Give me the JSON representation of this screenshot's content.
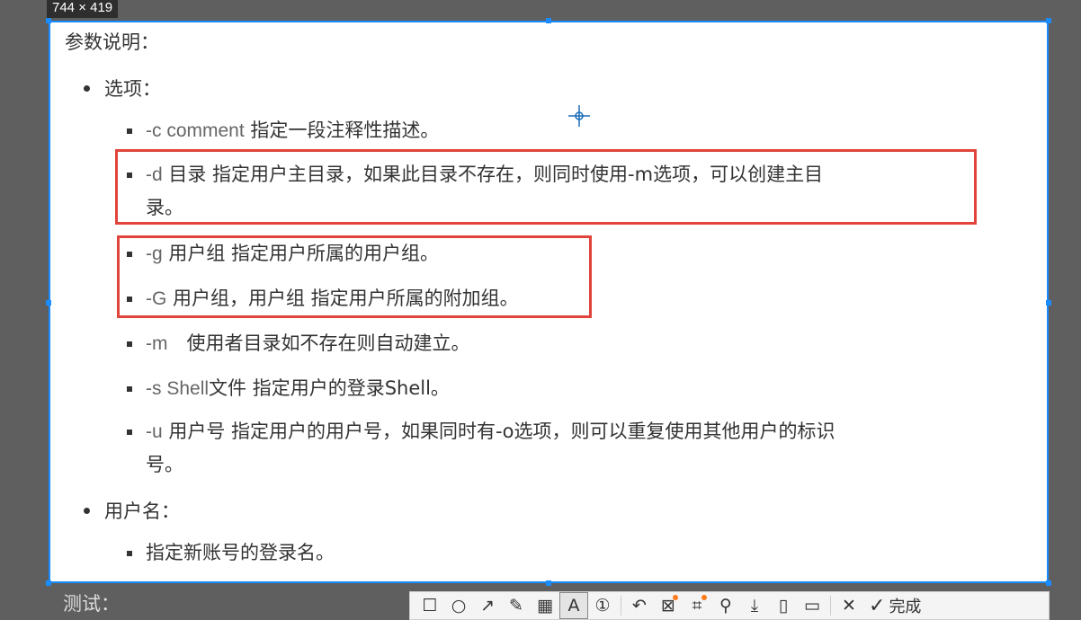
{
  "badge": {
    "size": "744 × 419"
  },
  "content": {
    "heading": "参数说明：",
    "sections": [
      {
        "label": "选项：",
        "items": [
          {
            "cmd": "-c comment",
            "text": " 指定一段注释性描述。"
          },
          {
            "cmd": "-d",
            "text": " 目录 指定用户主目录，如果此目录不存在，则同时使用-m选项，可以创建主目",
            "text2": "录。"
          },
          {
            "cmd": "-g",
            "text": " 用户组 指定用户所属的用户组。"
          },
          {
            "cmd": "-G",
            "text": " 用户组，用户组 指定用户所属的附加组。"
          },
          {
            "cmd": "-m",
            "text": "　使用者目录如不存在则自动建立。"
          },
          {
            "cmd": "-s Shell",
            "text": "文件 指定用户的登录Shell。"
          },
          {
            "cmd": "-u",
            "text": " 用户号 指定用户的用户号，如果同时有-o选项，则可以重复使用其他用户的标识",
            "text2": "号。"
          }
        ]
      },
      {
        "label": "用户名：",
        "items": [
          {
            "cmd": "",
            "text": "指定新账号的登录名。"
          }
        ]
      }
    ]
  },
  "below": {
    "text": "测试："
  },
  "toolbar": {
    "tools": [
      {
        "name": "rectangle-icon",
        "glyph": "☐"
      },
      {
        "name": "ellipse-icon",
        "glyph": "○"
      },
      {
        "name": "arrow-icon",
        "glyph": "↗"
      },
      {
        "name": "pencil-icon",
        "glyph": "✎"
      },
      {
        "name": "mosaic-icon",
        "glyph": "▦"
      },
      {
        "name": "text-icon",
        "glyph": "A"
      },
      {
        "name": "number-icon",
        "glyph": "①"
      },
      {
        "name": "undo-icon",
        "glyph": "↶"
      },
      {
        "name": "pin-erase-icon",
        "glyph": "⊠"
      },
      {
        "name": "ocr-icon",
        "glyph": "⌗"
      },
      {
        "name": "pin-icon",
        "glyph": "⚲"
      },
      {
        "name": "download-icon",
        "glyph": "⤓"
      },
      {
        "name": "save-icon",
        "glyph": "▯"
      },
      {
        "name": "copy-icon",
        "glyph": "▭"
      }
    ],
    "cancel_glyph": "✕",
    "done_label": "完成",
    "done_glyph": "✓",
    "accent": "#1a8cff",
    "highlight": "#e0443b"
  }
}
